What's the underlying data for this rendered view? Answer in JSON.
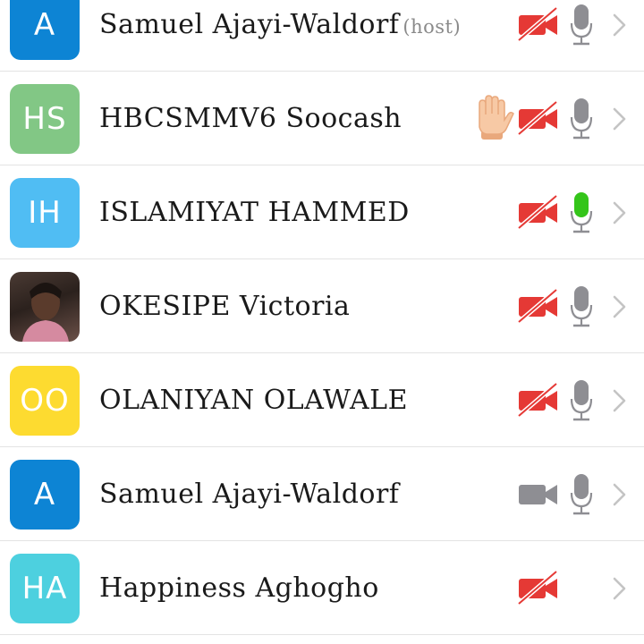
{
  "participants": [
    {
      "initials": "A",
      "name": "Samuel Ajayi-Waldorf",
      "tag": "(host)",
      "avatar_color": "#0d84d4",
      "video": "off",
      "mic": "muted",
      "hand_raised": false
    },
    {
      "initials": "HS",
      "name": "HBCSMMV6 Soocash",
      "tag": "",
      "avatar_color": "#82c785",
      "video": "off",
      "mic": "muted",
      "hand_raised": true
    },
    {
      "initials": "IH",
      "name": "ISLAMIYAT HAMMED",
      "tag": "",
      "avatar_color": "#50bdf3",
      "video": "off",
      "mic": "speaking",
      "hand_raised": false
    },
    {
      "initials": "",
      "name": "OKESIPE Victoria",
      "tag": "",
      "avatar_color": "photo",
      "video": "off",
      "mic": "muted",
      "hand_raised": false
    },
    {
      "initials": "OO",
      "name": "OLANIYAN OLAWALE",
      "tag": "",
      "avatar_color": "#fddb30",
      "video": "off",
      "mic": "muted",
      "hand_raised": false
    },
    {
      "initials": "A",
      "name": "Samuel Ajayi-Waldorf",
      "tag": "",
      "avatar_color": "#0d84d4",
      "video": "on",
      "mic": "muted",
      "hand_raised": false
    },
    {
      "initials": "HA",
      "name": "Happiness Aghogho",
      "tag": "",
      "avatar_color": "#4dd0df",
      "video": "off",
      "mic": "none",
      "hand_raised": false
    }
  ],
  "colors": {
    "video_off": "#e53935",
    "icon_gray": "#8e8e93",
    "mic_speaking": "#34c51a",
    "chevron": "#c4c4c4",
    "hand": "#f7c9a5"
  },
  "icons": {
    "video_off": "video-off-icon",
    "video_on": "video-icon",
    "mic": "microphone-icon",
    "hand": "raised-hand-icon",
    "chevron": "chevron-right-icon"
  }
}
